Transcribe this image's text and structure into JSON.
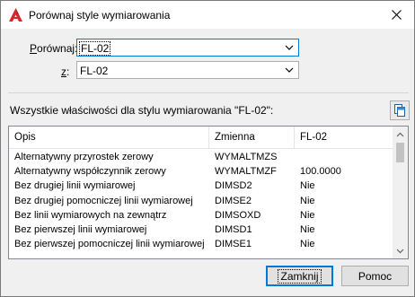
{
  "window": {
    "title": "Porównaj style wymiarowania"
  },
  "icons": {
    "app": "autocad-icon",
    "close": "close-icon",
    "copy": "copy-to-clipboard-icon",
    "chevron": "chevron-down-icon"
  },
  "compare": {
    "label_prefix": "",
    "label_mnemonic": "P",
    "label_rest": "orównaj:",
    "value": "FL-02"
  },
  "with": {
    "label_prefix": "",
    "label_mnemonic": "z",
    "label_rest": ":",
    "value": "FL-02"
  },
  "all_properties_label": "Wszystkie właściwości dla stylu wymiarowania \"FL-02\":",
  "table": {
    "columns": [
      "Opis",
      "Zmienna",
      "FL-02"
    ],
    "rows": [
      [
        "Alternatywny przyrostek zerowy",
        "WYMALTMZS",
        ""
      ],
      [
        "Alternatywny współczynnik zerowy",
        "WYMALTMZF",
        "100.0000"
      ],
      [
        "Bez drugiej linii wymiarowej",
        "DIMSD2",
        "Nie"
      ],
      [
        "Bez drugiej pomocniczej linii wymiarowej",
        "DIMSE2",
        "Nie"
      ],
      [
        "Bez linii wymiarowych na zewnątrz",
        "DIMSOXD",
        "Nie"
      ],
      [
        "Bez pierwszej linii wymiarowej",
        "DIMSD1",
        "Nie"
      ],
      [
        "Bez pierwszej pomocniczej linii wymiarowej",
        "DIMSE1",
        "Nie"
      ]
    ]
  },
  "buttons": {
    "close": "Zamknij",
    "help": "Pomoc"
  },
  "colors": {
    "accent": "#0078d7",
    "app_icon_red": "#d9262c"
  }
}
